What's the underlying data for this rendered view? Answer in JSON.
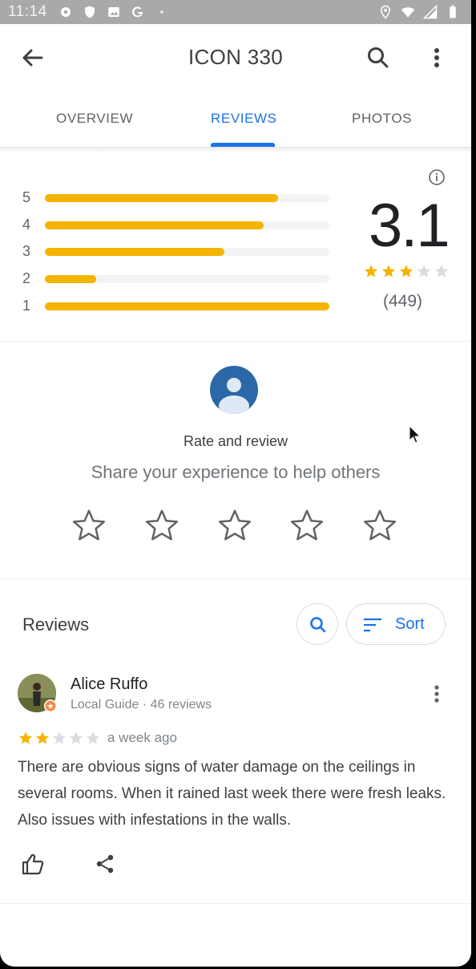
{
  "status_bar": {
    "time": "11:14"
  },
  "app_bar": {
    "title": "ICON 330"
  },
  "tabs": [
    {
      "label": "OVERVIEW",
      "active": false
    },
    {
      "label": "REVIEWS",
      "active": true
    },
    {
      "label": "PHOTOS",
      "active": false
    }
  ],
  "rating_summary": {
    "average": "3.1",
    "count": "(449)",
    "stars_filled": 3,
    "stars_total": 5,
    "distribution": [
      {
        "stars": "5",
        "fraction": 0.82
      },
      {
        "stars": "4",
        "fraction": 0.77
      },
      {
        "stars": "3",
        "fraction": 0.63
      },
      {
        "stars": "2",
        "fraction": 0.18
      },
      {
        "stars": "1",
        "fraction": 1.0
      }
    ]
  },
  "rate_prompt": {
    "title": "Rate and review",
    "subtitle": "Share your experience to help others",
    "star_count": 5
  },
  "reviews_section": {
    "title": "Reviews",
    "sort_label": "Sort"
  },
  "reviews": [
    {
      "author": "Alice Ruffo",
      "meta": "Local Guide · 46 reviews",
      "rating": 2,
      "time": "a week ago",
      "text": "There are obvious signs of water damage on the ceilings in several rooms.  When it rained last week there were fresh leaks.  Also issues with infestations in the walls."
    }
  ],
  "colors": {
    "accent": "#1a73e8",
    "star": "#f4b400",
    "star_empty": "#dadce0",
    "avatar_blue": "#2a68a8"
  }
}
